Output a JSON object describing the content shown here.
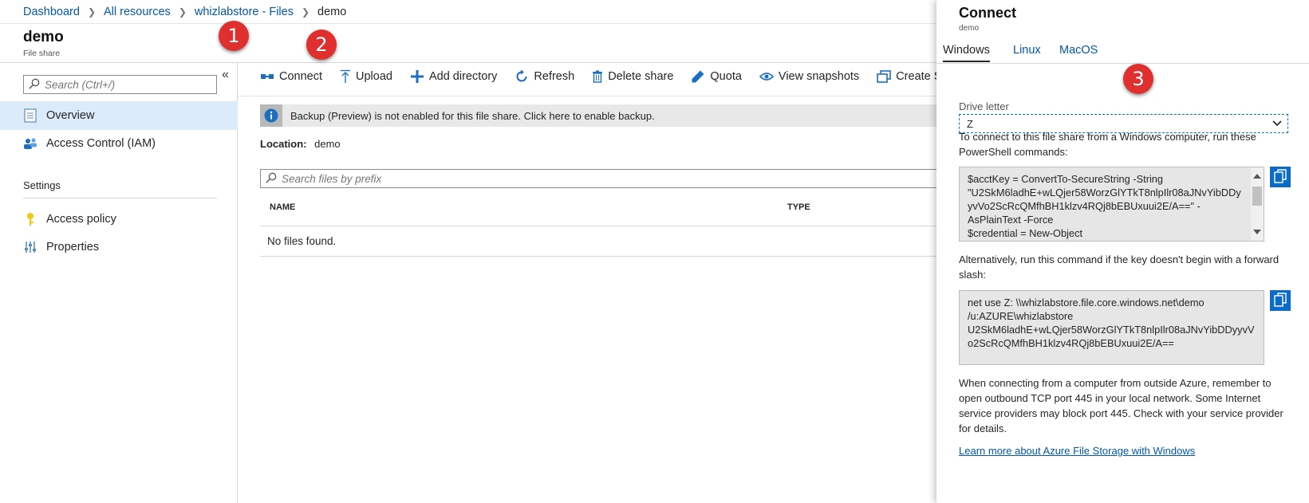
{
  "breadcrumb": {
    "items": [
      "Dashboard",
      "All resources",
      "whizlabstore - Files"
    ],
    "current": "demo"
  },
  "header": {
    "title": "demo",
    "subtitle": "File share"
  },
  "leftnav": {
    "search_placeholder": "Search (Ctrl+/)",
    "collapse": "«",
    "items": [
      {
        "label": "Overview",
        "icon": "overview-icon",
        "active": true
      },
      {
        "label": "Access Control (IAM)",
        "icon": "people-icon"
      }
    ],
    "section_title": "Settings",
    "settings_items": [
      {
        "label": "Access policy",
        "icon": "key-icon"
      },
      {
        "label": "Properties",
        "icon": "sliders-icon"
      }
    ]
  },
  "toolbar": {
    "connect": "Connect",
    "upload": "Upload",
    "add_directory": "Add directory",
    "refresh": "Refresh",
    "delete_share": "Delete share",
    "quota": "Quota",
    "view_snapshots": "View snapshots",
    "create_snapshot": "Create S"
  },
  "banner": {
    "text": "Backup (Preview) is not enabled for this file share. Click here to enable backup."
  },
  "location": {
    "label": "Location:",
    "value": "demo"
  },
  "files": {
    "search_placeholder": "Search files by prefix",
    "columns": [
      "NAME",
      "TYPE"
    ],
    "empty_text": "No files found."
  },
  "steps": [
    "1",
    "2",
    "3"
  ],
  "connect_panel": {
    "title": "Connect",
    "subtitle": "demo",
    "tabs": [
      "Windows",
      "Linux",
      "MacOS"
    ],
    "drive_label": "Drive letter",
    "drive_value": "Z",
    "intro_text": "To connect to this file share from a Windows computer, run these PowerShell commands:",
    "powershell_lines": [
      "$acctKey = ConvertTo-SecureString -String",
      "\"U2SkM6ladhE+wLQjer58WorzGlYTkT8nlpIlr08aJNvYibDDyyvVo2ScRcQMfhBH1klzv4RQj8bEBUxuui2E/A==\" -",
      "AsPlainText -Force",
      "$credential = New-Object"
    ],
    "alt_text": "Alternatively, run this command if the key doesn't begin with a forward slash:",
    "net_use_lines": [
      "net use Z: \\\\whizlabstore.file.core.windows.net\\demo",
      "/u:AZURE\\whizlabstore",
      "U2SkM6ladhE+wLQjer58WorzGlYTkT8nlpIlr08aJNvYibDDyyvVo2ScRcQMfhBH1klzv4RQj8bEBUxuui2E/A=="
    ],
    "note_text": "When connecting from a computer from outside Azure, remember to open outbound TCP port 445 in your local network. Some Internet service providers may block port 445. Check with your service provider for details.",
    "learn_link": "Learn more about Azure File Storage with Windows"
  },
  "colors": {
    "link": "#0058ad",
    "accent": "#0078d7",
    "step_marker": "#e02f2f",
    "active_nav": "#dcebf9"
  }
}
